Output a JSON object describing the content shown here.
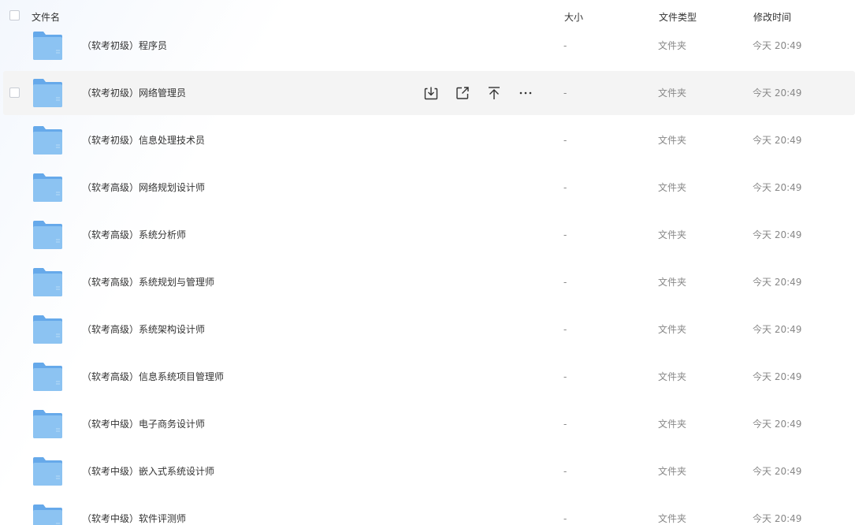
{
  "header": {
    "name": "文件名",
    "size": "大小",
    "type": "文件类型",
    "time": "修改时间"
  },
  "colors": {
    "folder_body": "#8cc3f2",
    "folder_tab": "#66a9ea",
    "hover_row": "#f4f4f4"
  },
  "rows": [
    {
      "name": "（软考初级）程序员",
      "size": "-",
      "type": "文件夹",
      "time": "今天 20:49"
    },
    {
      "name": "（软考初级）网络管理员",
      "size": "-",
      "type": "文件夹",
      "time": "今天 20:49"
    },
    {
      "name": "（软考初级）信息处理技术员",
      "size": "-",
      "type": "文件夹",
      "time": "今天 20:49"
    },
    {
      "name": "（软考高级）网络规划设计师",
      "size": "-",
      "type": "文件夹",
      "time": "今天 20:49"
    },
    {
      "name": "（软考高级）系统分析师",
      "size": "-",
      "type": "文件夹",
      "time": "今天 20:49"
    },
    {
      "name": "（软考高级）系统规划与管理师",
      "size": "-",
      "type": "文件夹",
      "time": "今天 20:49"
    },
    {
      "name": "（软考高级）系统架构设计师",
      "size": "-",
      "type": "文件夹",
      "time": "今天 20:49"
    },
    {
      "name": "（软考高级）信息系统项目管理师",
      "size": "-",
      "type": "文件夹",
      "time": "今天 20:49"
    },
    {
      "name": "（软考中级）电子商务设计师",
      "size": "-",
      "type": "文件夹",
      "time": "今天 20:49"
    },
    {
      "name": "（软考中级）嵌入式系统设计师",
      "size": "-",
      "type": "文件夹",
      "time": "今天 20:49"
    },
    {
      "name": "（软考中级）软件评测师",
      "size": "-",
      "type": "文件夹",
      "time": "今天 20:49"
    }
  ],
  "hovered_row_actions": [
    "download-icon",
    "share-icon",
    "move-to-top-icon",
    "more-icon"
  ]
}
